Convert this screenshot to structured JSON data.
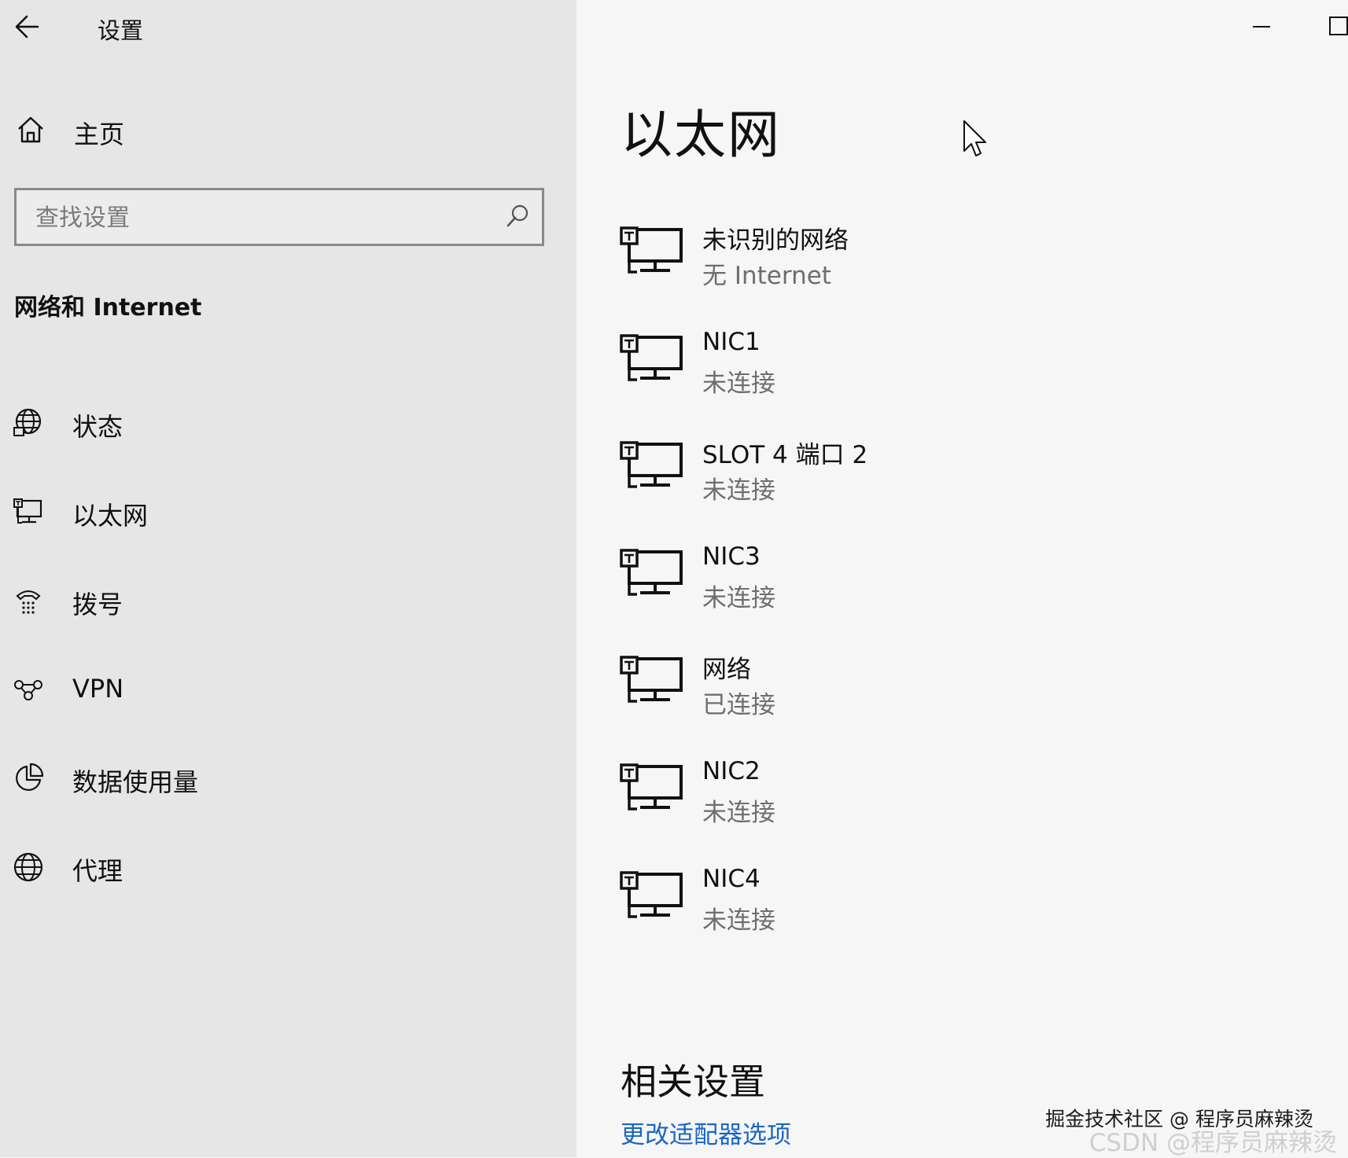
{
  "app": {
    "title": "设置"
  },
  "sidebar": {
    "home_label": "主页",
    "search": {
      "placeholder": "查找设置",
      "value": ""
    },
    "section_heading": "网络和 Internet",
    "items": [
      {
        "label": "状态",
        "icon": "globe-status-icon"
      },
      {
        "label": "以太网",
        "icon": "ethernet-icon"
      },
      {
        "label": "拨号",
        "icon": "dial-up-icon"
      },
      {
        "label": "VPN",
        "icon": "vpn-icon"
      },
      {
        "label": "数据使用量",
        "icon": "data-usage-icon"
      },
      {
        "label": "代理",
        "icon": "globe-icon"
      }
    ]
  },
  "main": {
    "title": "以太网",
    "networks": [
      {
        "name": "未识别的网络",
        "status": "无 Internet"
      },
      {
        "name": "NIC1",
        "status": "未连接"
      },
      {
        "name": "SLOT 4 端口 2",
        "status": "未连接"
      },
      {
        "name": "NIC3",
        "status": "未连接"
      },
      {
        "name": "网络",
        "status": "已连接"
      },
      {
        "name": "NIC2",
        "status": "未连接"
      },
      {
        "name": "NIC4",
        "status": "未连接"
      }
    ],
    "related_heading": "相关设置",
    "related_link": "更改适配器选项"
  },
  "watermark": {
    "text": "掘金技术社区 @ 程序员麻辣烫",
    "ghost": "CSDN @程序员麻辣烫"
  },
  "colors": {
    "sidebar_bg": "#e6e6e6",
    "main_bg": "#f6f6f6",
    "link": "#1a66c2",
    "secondary_text": "#6e6e6e"
  }
}
